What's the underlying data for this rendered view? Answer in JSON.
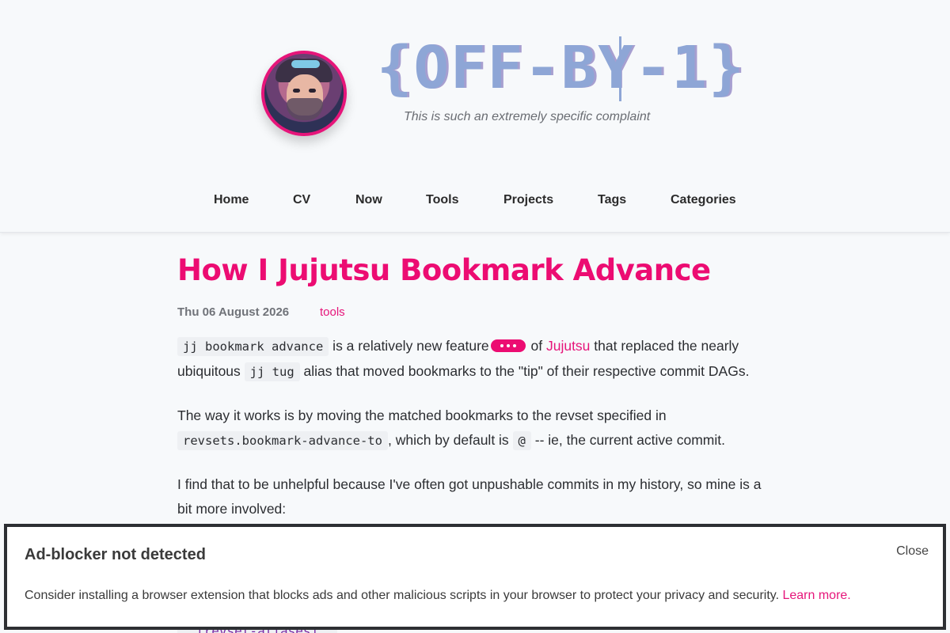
{
  "header": {
    "logo": "{OFF-BY-1}",
    "tagline": "This is such an extremely specific complaint"
  },
  "nav": [
    {
      "label": "Home"
    },
    {
      "label": "CV"
    },
    {
      "label": "Now"
    },
    {
      "label": "Tools"
    },
    {
      "label": "Projects"
    },
    {
      "label": "Tags"
    },
    {
      "label": "Categories"
    }
  ],
  "post": {
    "title": "How I Jujutsu Bookmark Advance",
    "date": "Thu 06 August 2026",
    "tag": "tools",
    "p1": {
      "code1": "jj bookmark advance",
      "text1": " is a relatively new feature",
      "text2": " of ",
      "link": "Jujutsu",
      "text3": " that replaced the nearly ubiquitous ",
      "code2": "jj tug",
      "text4": " alias that moved bookmarks to the \"tip\" of their respective commit DAGs."
    },
    "p2": {
      "text1": "The way it works is by moving the matched bookmarks to the revset specified in ",
      "code1": "revsets.bookmark-advance-to",
      "text2": ", which by default is ",
      "code2": "@",
      "text3": " -- ie, the current active commit."
    },
    "p3": {
      "text1": "I find that to be unhelpful because I've often got unpushable commits in my history, so mine is a bit more involved:"
    },
    "code_peek": "[revset-aliases]"
  },
  "banner": {
    "title": "Ad-blocker not detected",
    "close": "Close",
    "text": "Consider installing a browser extension that blocks ads and other malicious scripts in your browser to protect your privacy and security. ",
    "link": "Learn more."
  },
  "colors": {
    "accent": "#ec0c72",
    "logo": "#8ea6d6"
  }
}
